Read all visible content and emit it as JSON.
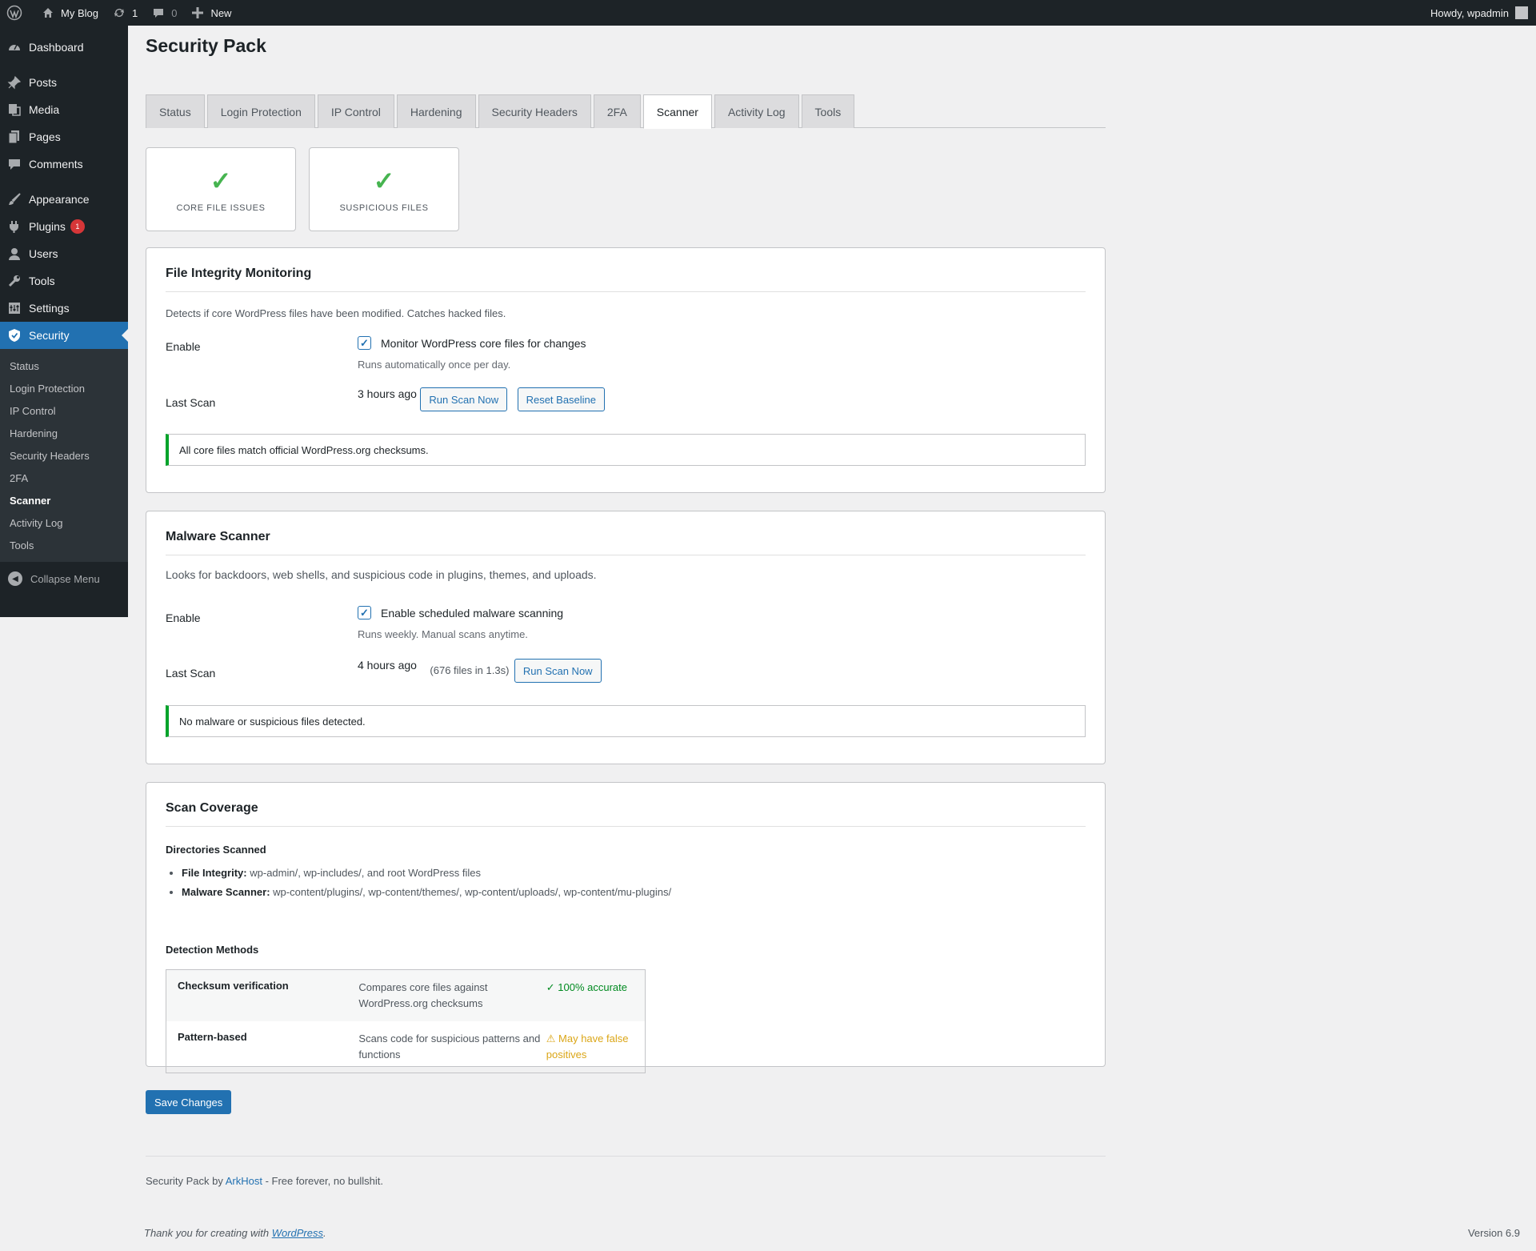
{
  "adminbar": {
    "site_name": "My Blog",
    "updates_count": "1",
    "comments_count": "0",
    "new_label": "New",
    "greeting": "Howdy, wpadmin"
  },
  "sidebar": {
    "items": [
      {
        "label": "Dashboard",
        "icon": "dashboard-icon"
      },
      {
        "label": "Posts",
        "icon": "pin-icon"
      },
      {
        "label": "Media",
        "icon": "media-icon"
      },
      {
        "label": "Pages",
        "icon": "pages-icon"
      },
      {
        "label": "Comments",
        "icon": "comment-icon"
      },
      {
        "label": "Appearance",
        "icon": "brush-icon"
      },
      {
        "label": "Plugins",
        "icon": "plugin-icon",
        "badge": "1"
      },
      {
        "label": "Users",
        "icon": "user-icon"
      },
      {
        "label": "Tools",
        "icon": "wrench-icon"
      },
      {
        "label": "Settings",
        "icon": "settings-icon"
      },
      {
        "label": "Security",
        "icon": "shield-icon"
      }
    ],
    "submenu": [
      "Status",
      "Login Protection",
      "IP Control",
      "Hardening",
      "Security Headers",
      "2FA",
      "Scanner",
      "Activity Log",
      "Tools"
    ],
    "collapse_label": "Collapse Menu"
  },
  "page": {
    "title": "Security Pack",
    "tabs": [
      "Status",
      "Login Protection",
      "IP Control",
      "Hardening",
      "Security Headers",
      "2FA",
      "Scanner",
      "Activity Log",
      "Tools"
    ],
    "active_tab": "Scanner"
  },
  "stats": [
    {
      "symbol": "✓",
      "label": "CORE FILE ISSUES"
    },
    {
      "symbol": "✓",
      "label": "SUSPICIOUS FILES"
    }
  ],
  "file_integrity": {
    "title": "File Integrity Monitoring",
    "description": "Detects if core WordPress files have been modified. Catches hacked files.",
    "enable_label": "Enable",
    "checkbox_label": "Monitor WordPress core files for changes",
    "checked": true,
    "help": "Runs automatically once per day.",
    "last_scan_label": "Last Scan",
    "last_scan_value": "3 hours ago",
    "run_button": "Run Scan Now",
    "reset_button": "Reset Baseline",
    "notice": "All core files match official WordPress.org checksums."
  },
  "malware": {
    "title": "Malware Scanner",
    "description": "Looks for backdoors, web shells, and suspicious code in plugins, themes, and uploads.",
    "enable_label": "Enable",
    "checkbox_label": "Enable scheduled malware scanning",
    "checked": true,
    "help": "Runs weekly. Manual scans anytime.",
    "last_scan_label": "Last Scan",
    "last_scan_value": "4 hours ago",
    "scan_meta": "(676 files in 1.3s)",
    "run_button": "Run Scan Now",
    "notice": "No malware or suspicious files detected."
  },
  "coverage": {
    "title": "Scan Coverage",
    "directories_heading": "Directories Scanned",
    "directories": [
      {
        "name": "File Integrity:",
        "value": "wp-admin/, wp-includes/, and root WordPress files"
      },
      {
        "name": "Malware Scanner:",
        "value": "wp-content/plugins/, wp-content/themes/, wp-content/uploads/, wp-content/mu-plugins/"
      }
    ],
    "methods_heading": "Detection Methods",
    "methods": [
      {
        "name": "Checksum verification",
        "desc": "Compares core files against WordPress.org checksums",
        "status": "✓ 100% accurate",
        "status_color": "#008a20"
      },
      {
        "name": "Pattern-based",
        "desc": "Scans code for suspicious patterns and functions",
        "status": "⚠ May have false positives",
        "status_color": "#dba617"
      }
    ]
  },
  "save_button": "Save Changes",
  "footer": {
    "credit_prefix": "Security Pack by",
    "credit_link": "ArkHost",
    "credit_suffix": "- Free forever, no bullshit.",
    "thanks_prefix": "Thank you for creating with",
    "thanks_link": "WordPress",
    "thanks_suffix": ".",
    "version": "Version 6.9"
  },
  "colors": {
    "accent": "#2271b1",
    "sidebar_bg": "#1d2327",
    "success": "#00a32a",
    "warning": "#dba617",
    "badge": "#d63638"
  }
}
